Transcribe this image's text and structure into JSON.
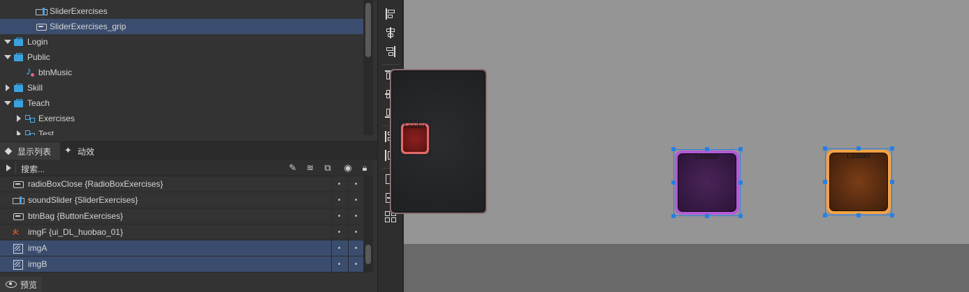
{
  "hierarchy": {
    "rows": [
      {
        "label": "SliderExercises",
        "icon": "slider-icon",
        "arrow": "",
        "indent": 2,
        "selected": false
      },
      {
        "label": "SliderExercises_grip",
        "icon": "button-icon",
        "arrow": "",
        "indent": 2,
        "selected": true
      },
      {
        "label": "Login",
        "icon": "folder-icon",
        "arrow": "down",
        "indent": 0,
        "selected": false
      },
      {
        "label": "Public",
        "icon": "folder-icon",
        "arrow": "down",
        "indent": 0,
        "selected": false
      },
      {
        "label": "btnMusic",
        "icon": "music-icon",
        "arrow": "",
        "indent": 1,
        "selected": false
      },
      {
        "label": "Skill",
        "icon": "folder-icon",
        "arrow": "right",
        "indent": 0,
        "selected": false
      },
      {
        "label": "Teach",
        "icon": "folder-icon",
        "arrow": "down",
        "indent": 0,
        "selected": false
      },
      {
        "label": "Exercises",
        "icon": "component-icon",
        "arrow": "right",
        "indent": 1,
        "selected": false
      },
      {
        "label": "Test",
        "icon": "component-icon",
        "arrow": "right",
        "indent": 1,
        "selected": false
      }
    ]
  },
  "tabs": {
    "display_list": "显示列表",
    "animation": "动效"
  },
  "search": {
    "placeholder": "搜索..."
  },
  "display_list": {
    "rows": [
      {
        "label": "radioBoxClose {RadioBoxExercises}",
        "icon": "button-icon",
        "selected": false
      },
      {
        "label": "soundSlider {SliderExercises}",
        "icon": "slider-icon",
        "selected": false
      },
      {
        "label": "btnBag {ButtonExercises}",
        "icon": "button-icon",
        "selected": false
      },
      {
        "label": "imgF {ui_DL_huobao_01}",
        "icon": "fire-image-icon",
        "selected": false
      },
      {
        "label": "imgA",
        "icon": "image-icon",
        "selected": true
      },
      {
        "label": "imgB",
        "icon": "image-icon",
        "selected": true
      }
    ],
    "dot": "•"
  },
  "preview": {
    "label": "预览"
  },
  "canvas": {
    "loaders": [
      {
        "label": "Loader",
        "color": "#b25bd6"
      },
      {
        "label": "Loader",
        "color": "#f5a244"
      }
    ],
    "red_button_label": "Loader"
  },
  "colors": {
    "selection": "#3b4d6e",
    "folder": "#3aa3df",
    "handle": "#2a7fe0"
  }
}
